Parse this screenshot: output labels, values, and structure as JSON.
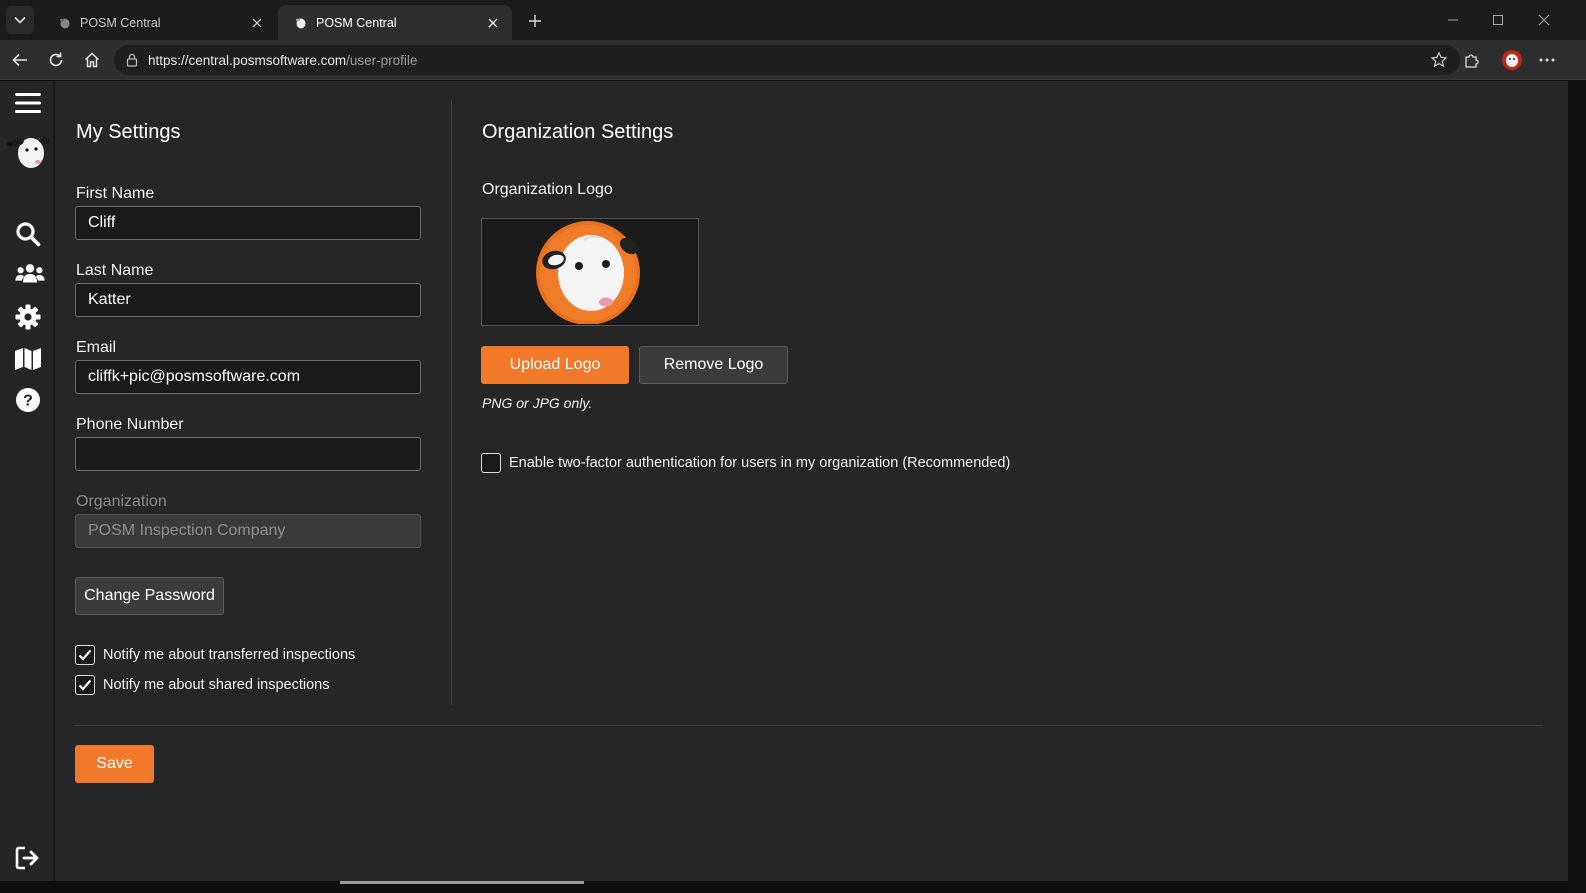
{
  "browser": {
    "tabs": [
      {
        "title": "POSM Central",
        "active": false
      },
      {
        "title": "POSM Central",
        "active": true
      }
    ],
    "url_host": "https://central.posmsoftware.com",
    "url_path": "/user-profile"
  },
  "sidebar": {
    "items": [
      "menu-icon",
      "logo",
      "search-icon",
      "users-icon",
      "gear-icon",
      "map-icon",
      "help-icon",
      "logout-icon"
    ]
  },
  "my_settings": {
    "title": "My Settings",
    "first_name_label": "First Name",
    "first_name_value": "Cliff",
    "last_name_label": "Last Name",
    "last_name_value": "Katter",
    "email_label": "Email",
    "email_value": "cliffk+pic@posmsoftware.com",
    "phone_label": "Phone Number",
    "phone_value": "",
    "org_label": "Organization",
    "org_value": "POSM Inspection Company",
    "change_password_label": "Change Password",
    "notify_transferred_label": "Notify me about transferred inspections",
    "notify_transferred_checked": true,
    "notify_shared_label": "Notify me about shared inspections",
    "notify_shared_checked": true
  },
  "org_settings": {
    "title": "Organization Settings",
    "logo_label": "Organization Logo",
    "upload_label": "Upload Logo",
    "remove_label": "Remove Logo",
    "format_hint": "PNG or JPG only.",
    "two_factor_label": "Enable two-factor authentication for users in my organization (Recommended)",
    "two_factor_checked": false
  },
  "footer": {
    "save_label": "Save"
  },
  "colors": {
    "accent": "#f0792a",
    "background": "#262626"
  }
}
